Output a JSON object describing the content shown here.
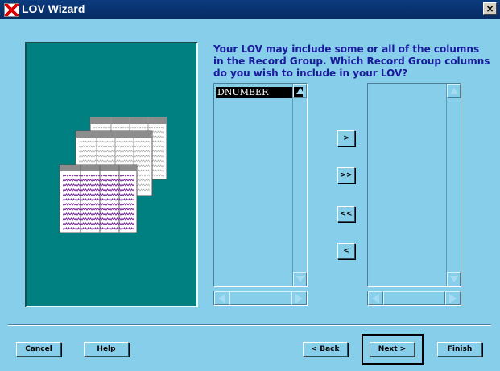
{
  "window": {
    "title": "LOV Wizard",
    "close_glyph": "×",
    "icon": "lov-wizard-app-icon"
  },
  "instructions": "Your LOV may include some or all of the columns in the Record Group. Which Record Group columns do you wish to include in your LOV?",
  "available_columns": [
    "DNUMBER"
  ],
  "selected_columns": [],
  "move_buttons": {
    "move_selected": ">",
    "move_all": ">>",
    "remove_all": "<<",
    "remove_selected": "<"
  },
  "buttons": {
    "cancel": "Cancel",
    "help": "Help",
    "back": "< Back",
    "next": "Next >",
    "finish": "Finish"
  },
  "colors": {
    "background": "#87ceeb",
    "title_bar": "#0b3a7e",
    "image_panel": "#008080",
    "instruction_text": "#1a1a9c",
    "sheet_glyph_purple": "#7a2a9a"
  },
  "icons": [
    "close-icon",
    "record-group-sheets-illustration",
    "scroll-up-icon",
    "scroll-down-icon",
    "scroll-left-icon",
    "scroll-right-icon"
  ]
}
